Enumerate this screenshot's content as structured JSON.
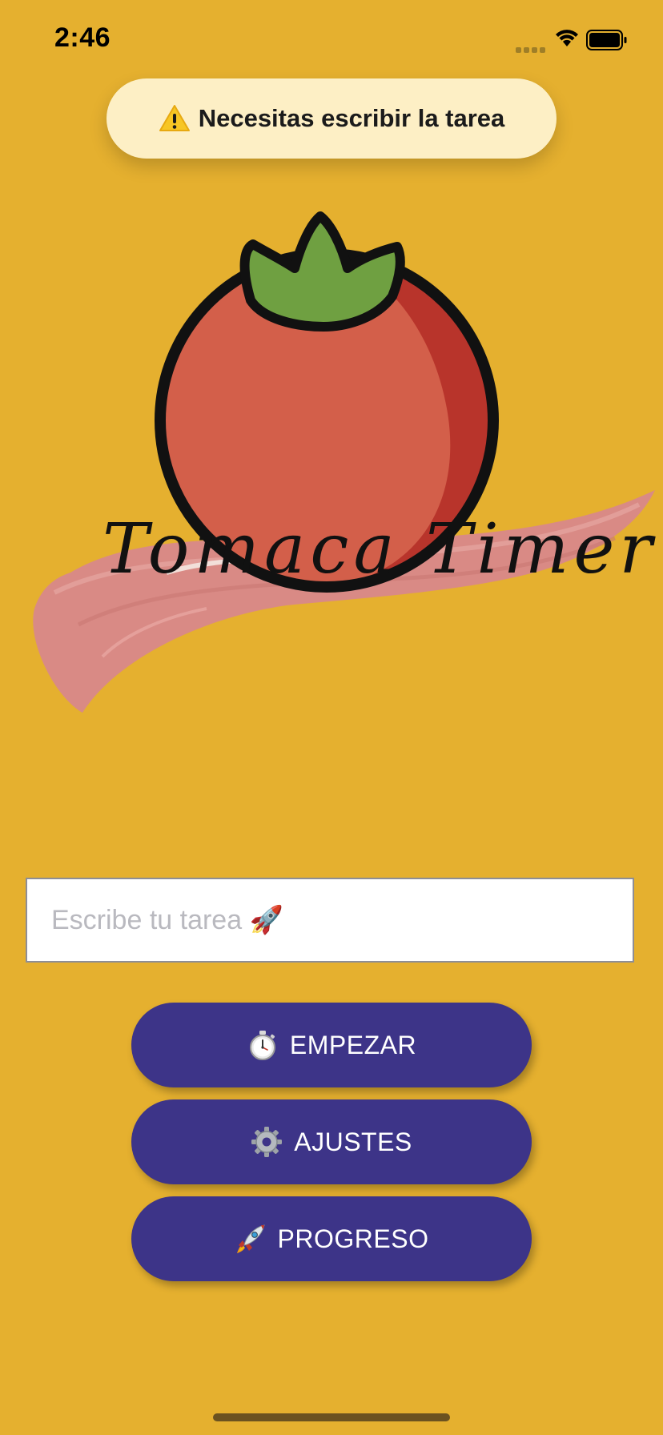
{
  "status_bar": {
    "time": "2:46"
  },
  "toast": {
    "icon": "warning-icon",
    "message": "Necesitas escribir la tarea"
  },
  "logo": {
    "text": "Tomaca Timer"
  },
  "task_input": {
    "placeholder": "Escribe tu tarea 🚀",
    "value": ""
  },
  "buttons": {
    "start": {
      "icon": "stopwatch-icon",
      "label": "EMPEZAR"
    },
    "settings": {
      "icon": "gear-icon",
      "label": "AJUSTES"
    },
    "progress": {
      "icon": "rocket-icon",
      "label": "PROGRESO"
    }
  },
  "colors": {
    "background": "#E5B02F",
    "button": "#3D3488",
    "toast": "#FDEFC5",
    "tomato": "#D35F4A",
    "leaf": "#6FA041",
    "brush": "#D98A85"
  }
}
